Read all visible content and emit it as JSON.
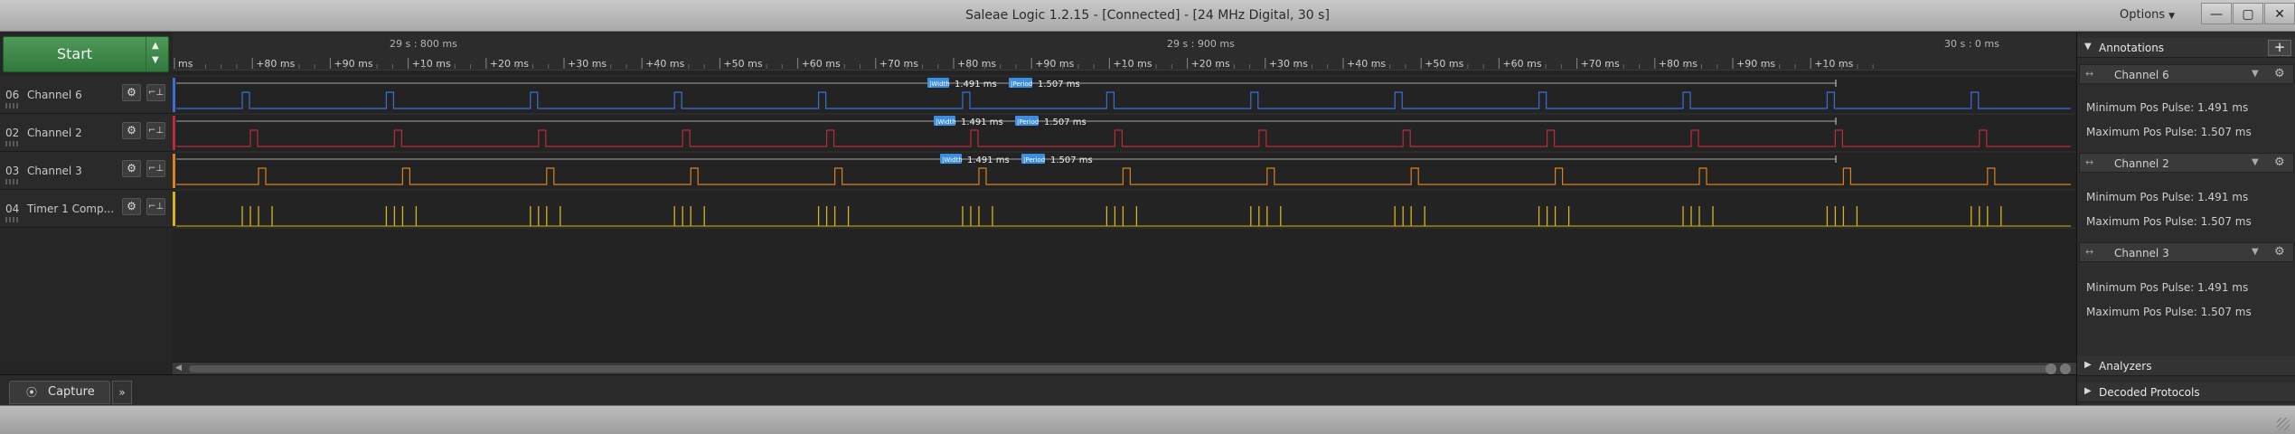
{
  "window": {
    "title": "Saleae Logic 1.2.15 - [Connected] - [24 MHz Digital, 30 s]",
    "options_label": "Options",
    "minimize": "—",
    "maximize": "▢",
    "close": "✕"
  },
  "start": {
    "label": "Start"
  },
  "channels": [
    {
      "num": "06",
      "name": "Channel 6",
      "color": "#3a6fd8"
    },
    {
      "num": "02",
      "name": "Channel 2",
      "color": "#c0283c"
    },
    {
      "num": "03",
      "name": "Channel 3",
      "color": "#d9821e"
    },
    {
      "num": "04",
      "name": "Timer 1 Comp...",
      "color": "#d8b41a"
    }
  ],
  "ruler": {
    "major_labels": [
      "29 s : 800 ms",
      "29 s : 900 ms",
      "30 s : 0 ms"
    ],
    "minor_labels": [
      "ms",
      "+80 ms",
      "+90 ms",
      "+10 ms",
      "+20 ms",
      "+30 ms",
      "+40 ms",
      "+50 ms",
      "+60 ms",
      "+70 ms",
      "+80 ms",
      "+90 ms",
      "+10 ms",
      "+20 ms",
      "+30 ms",
      "+40 ms",
      "+50 ms",
      "+60 ms",
      "+70 ms",
      "+80 ms",
      "+90 ms",
      "+10 ms"
    ]
  },
  "measurements": [
    {
      "channel": "Channel 6",
      "width_tag": "|Width",
      "width": "1.491 ms",
      "period_tag": "|Period",
      "period": "1.507 ms"
    },
    {
      "channel": "Channel 2",
      "width_tag": "|Width",
      "width": "1.491 ms",
      "period_tag": "|Period",
      "period": "1.507 ms"
    },
    {
      "channel": "Channel 3",
      "width_tag": "|Width",
      "width": "1.491 ms",
      "period_tag": "|Period",
      "period": "1.507 ms"
    }
  ],
  "bottom": {
    "capture_label": "Capture",
    "more": "»"
  },
  "annotations": {
    "title": "Annotations",
    "add": "+",
    "groups": [
      {
        "name": "Channel 6",
        "min": "Minimum Pos Pulse: 1.491 ms",
        "max": "Maximum Pos Pulse: 1.507 ms"
      },
      {
        "name": "Channel 2",
        "min": "Minimum Pos Pulse: 1.491 ms",
        "max": "Maximum Pos Pulse: 1.507 ms"
      },
      {
        "name": "Channel 3",
        "min": "Minimum Pos Pulse: 1.491 ms",
        "max": "Maximum Pos Pulse: 1.507 ms"
      }
    ]
  },
  "analyzers": {
    "title": "Analyzers"
  },
  "decoded": {
    "title": "Decoded Protocols"
  }
}
